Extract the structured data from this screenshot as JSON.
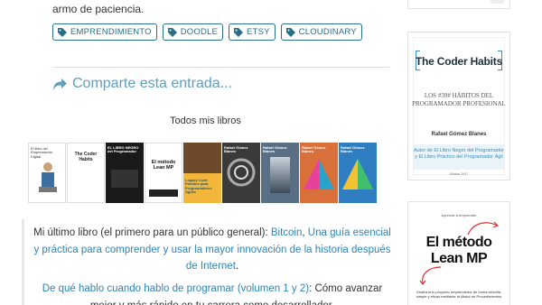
{
  "intro_tail": "armo de paciencia.",
  "tags": [
    "EMPRENDIMIENTO",
    "DOODLE",
    "ETSY",
    "CLOUDINARY"
  ],
  "share_label": "Comparte esta entrada...",
  "books_heading": "Todos mis libros",
  "book_covers": [
    {
      "title": "El libro del Emprendedor Digital",
      "bg": "#ffffff",
      "fg": "#333333"
    },
    {
      "title": "The Coder Habits",
      "bg": "#ffffff",
      "fg": "#222222"
    },
    {
      "title": "EL LIBRO NEGRO del Programador",
      "bg": "#1a1a1a",
      "fg": "#ffffff"
    },
    {
      "title": "El método Lean MP",
      "bg": "#ffffff",
      "fg": "#111111"
    },
    {
      "title": "Legacy Code Práctico para Programadores Ágiles",
      "bg": "#f2b63c",
      "fg": "#1f5a78"
    },
    {
      "title": "Rafael Gómez Blanes",
      "bg": "#3a3a3a",
      "fg": "#ffffff"
    },
    {
      "title": "Rafael Gómez Blanes",
      "bg": "#596f86",
      "fg": "#ffffff"
    },
    {
      "title": "Rafael Gómez Blanes",
      "bg": "#d96f3a",
      "fg": "#ffffff"
    },
    {
      "title": "Rafael Gómez Blanes",
      "bg": "#2f7ec2",
      "fg": "#ffffff"
    }
  ],
  "para1": {
    "before": "Mi último libro (el primero para un público general): ",
    "link1": "Bitcoin",
    "mid": ", ",
    "link2": "Una guía esencial y práctica para comprender y usar la mayor innovación de la historia después de Internet",
    "after": "."
  },
  "para2": {
    "link": "De qué hablo cuando hablo de programar (volumen 1 y 2)",
    "after": ": Cómo avanzar mejor y más rápido en tu carrera como desarrollador."
  },
  "sidebar": {
    "coder_habits": {
      "title": "The Coder Habits",
      "subtitle": "Los #39# hábitos del programador profesional",
      "author": "Rafael Gómez Blanes",
      "band": "Autor de El Libro Negro del Programador y El Libro Práctico del Programador Ágil",
      "edition": "Edición 2017"
    },
    "lean_mp": {
      "top": "Aprende a emprender",
      "title_line1": "El método",
      "title_line2": "Lean MP",
      "desc": "Gestiona tu proyecto emprendedor de forma sencilla, simple y eficaz mediante la Matriz de Procedimientos"
    }
  },
  "colors": {
    "link": "#2f83b5",
    "tag": "#2b6f86",
    "share": "#5e9fbb",
    "accent": "#3c8dbc"
  }
}
